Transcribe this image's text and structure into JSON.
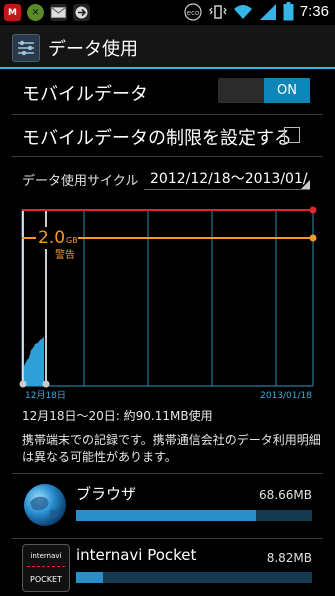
{
  "statusbar": {
    "time": "7:36",
    "left_icons": [
      "mcafee-icon",
      "xbox-icon",
      "email-icon",
      "sync-icon"
    ],
    "right_icons": [
      "eco-icon",
      "vibrate-icon",
      "wifi-icon",
      "signal-icon",
      "battery-icon"
    ],
    "eco_label": "eco"
  },
  "actionbar": {
    "title": "データ使用"
  },
  "mobile_data": {
    "label": "モバイルデータ",
    "toggle": "ON"
  },
  "limit": {
    "label": "モバイルデータの制限を設定する",
    "checked": false
  },
  "cycle": {
    "label": "データ使用サイクル",
    "value": "2012/12/18〜2013/01/"
  },
  "chart_data": {
    "type": "area",
    "warning": {
      "value": "2.0",
      "unit": "GB",
      "label": "警告"
    },
    "start_label": "12月18日",
    "end_label": "2013/01/18",
    "colors": {
      "limit": "#e8232f",
      "warning": "#f29a2b",
      "usage": "#2f9fd8",
      "grid": "#2d7696"
    }
  },
  "summary": "12月18日〜20日: 約90.11MB使用",
  "note": "携帯端末での記録です。携帯通信会社のデータ利用明細は異なる可能性があります。",
  "apps": [
    {
      "name": "ブラウザ",
      "size": "68.66MB",
      "fraction": 0.762,
      "icon": "globe-icon"
    },
    {
      "name": "internavi Pocket",
      "size": "8.82MB",
      "fraction": 0.098,
      "icon": "internavi-icon",
      "icon_top": "internavi",
      "icon_bottom": "POCKET"
    }
  ]
}
